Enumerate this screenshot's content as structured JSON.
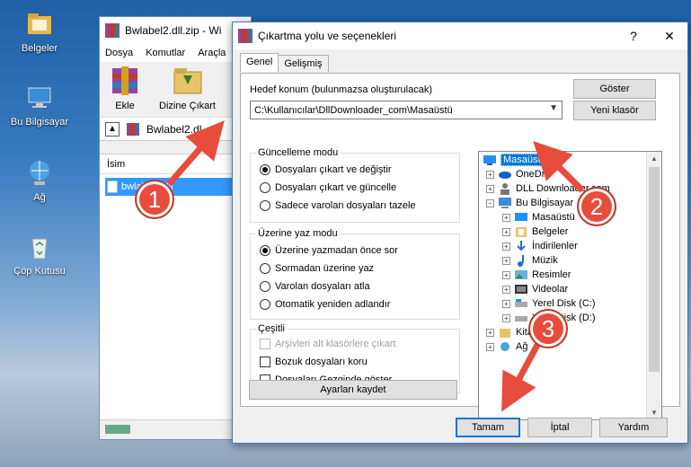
{
  "desktop": {
    "icons": [
      {
        "label": "Belgeler"
      },
      {
        "label": "Bu Bilgisayar"
      },
      {
        "label": "Ağ"
      },
      {
        "label": "Çöp Kutusu"
      }
    ]
  },
  "winrar": {
    "title": "Bwlabel2.dll.zip - Wi",
    "menu": [
      "Dosya",
      "Komutlar",
      "Araçla"
    ],
    "tools": {
      "add": "Ekle",
      "extract": "Dizine Çıkart"
    },
    "path": "Bwlabel2.dl",
    "column_name": "İsim",
    "file": "bwlabel2.dll"
  },
  "dialog": {
    "title": "Çıkartma yolu ve seçenekleri",
    "help": "?",
    "close": "✕",
    "tabs": [
      "Genel",
      "Gelişmiş"
    ],
    "dest_label": "Hedef konum (bulunmazsa oluşturulacak)",
    "dest_value": "C:\\Kullanıcılar\\DllDownloader_com\\Masaüstü",
    "btn_show": "Göster",
    "btn_new_folder": "Yeni klasör",
    "update_mode": {
      "title": "Güncelleme modu",
      "options": [
        "Dosyaları çıkart ve değiştir",
        "Dosyaları çıkart ve güncelle",
        "Sadece varolan dosyaları tazele"
      ],
      "selected": 0
    },
    "overwrite_mode": {
      "title": "Üzerine yaz modu",
      "options": [
        "Üzerine yazmadan önce sor",
        "Sormadan üzerine yaz",
        "Varolan dosyaları atla",
        "Otomatik yeniden adlandır"
      ],
      "selected": 0
    },
    "misc": {
      "title": "Çeşitli",
      "options": [
        "Arşivleri alt klasörlere çıkart",
        "Bozuk dosyaları koru",
        "Dosyaları Gezginde göster"
      ]
    },
    "btn_save": "Ayarları kaydet",
    "tree": [
      {
        "label": "Masaüstü",
        "icon": "desktop-icon"
      },
      {
        "label": "OneDri",
        "icon": "cloud-icon"
      },
      {
        "label": "DLL Downloader.com",
        "icon": "user-icon"
      },
      {
        "label": "Bu Bilgisayar",
        "icon": "computer-icon"
      },
      {
        "label": "Masaüstü",
        "icon": "desktop-icon"
      },
      {
        "label": "Belgeler",
        "icon": "documents-icon"
      },
      {
        "label": "İndirilenler",
        "icon": "download-icon"
      },
      {
        "label": "Müzik",
        "icon": "music-icon"
      },
      {
        "label": "Resimler",
        "icon": "pictures-icon"
      },
      {
        "label": "Videolar",
        "icon": "video-icon"
      },
      {
        "label": "Yerel Disk (C:)",
        "icon": "disk-icon"
      },
      {
        "label": "Yerel Disk (D:)",
        "icon": "disk-icon"
      },
      {
        "label": "Kitaplıklar",
        "icon": "library-icon"
      },
      {
        "label": "Ağ",
        "icon": "network-icon"
      }
    ],
    "btn_ok": "Tamam",
    "btn_cancel": "İptal",
    "btn_help": "Yardım"
  },
  "annotations": {
    "step1": "1",
    "step2": "2",
    "step3": "3",
    "color": "#e74c3c"
  }
}
